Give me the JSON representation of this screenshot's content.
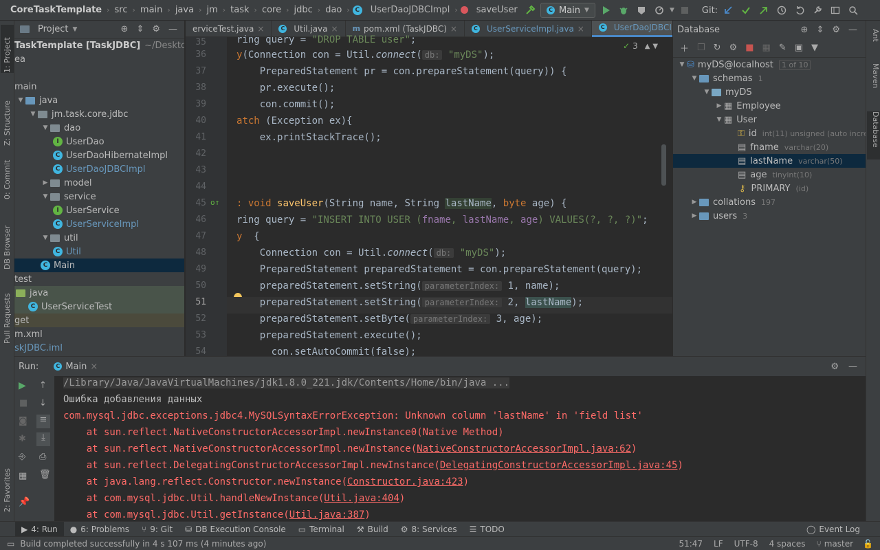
{
  "navbar": {
    "breadcrumbs": [
      "CoreTaskTemplate",
      "src",
      "main",
      "java",
      "jm",
      "task",
      "core",
      "jdbc",
      "dao"
    ],
    "file": "UserDaoJDBCImpl",
    "method": "saveUser",
    "run_config": "Main",
    "git_label": "Git:"
  },
  "left_stripe": {
    "project": "1: Project",
    "structure": "Z: Structure",
    "commit": "0: Commit",
    "db_browser": "DB Browser",
    "pull_requests": "Pull Requests",
    "favorites": "2: Favorites"
  },
  "right_stripe": {
    "ant": "Ant",
    "maven": "Maven",
    "database": "Database"
  },
  "project_panel": {
    "title": "Project",
    "root": "TaskTemplate [TaskJDBC]",
    "root_path": "~/Desktop/pr",
    "items": [
      {
        "label": "ea",
        "indent": 0
      },
      {
        "label": "",
        "indent": 0
      },
      {
        "label": "main",
        "indent": 1
      },
      {
        "label": "java",
        "indent": 1
      },
      {
        "label": "jm.task.core.jdbc",
        "indent": 2
      },
      {
        "label": "dao",
        "indent": 3
      },
      {
        "label": "UserDao",
        "indent": 4
      },
      {
        "label": "UserDaoHibernateImpl",
        "indent": 4
      },
      {
        "label": "UserDaoJDBCImpl",
        "indent": 4
      },
      {
        "label": "model",
        "indent": 3
      },
      {
        "label": "service",
        "indent": 3
      },
      {
        "label": "UserService",
        "indent": 4
      },
      {
        "label": "UserServiceImpl",
        "indent": 4
      },
      {
        "label": "util",
        "indent": 3
      },
      {
        "label": "Util",
        "indent": 4
      },
      {
        "label": "Main",
        "indent": 3
      },
      {
        "label": "test",
        "indent": 0
      },
      {
        "label": "java",
        "indent": 0
      },
      {
        "label": "UserServiceTest",
        "indent": 1
      },
      {
        "label": "get",
        "indent": 0
      },
      {
        "label": "m.xml",
        "indent": 0
      },
      {
        "label": "skJDBC.iml",
        "indent": 0
      }
    ]
  },
  "editor": {
    "tabs": [
      "erviceTest.java",
      "Util.java",
      "pom.xml (TaskJDBC)",
      "UserServiceImpl.java",
      "UserDaoJDBCImpl.java"
    ],
    "inspection_count": "3",
    "lines": [
      {
        "n": "35"
      },
      {
        "n": "36"
      },
      {
        "n": "37"
      },
      {
        "n": "38"
      },
      {
        "n": "39"
      },
      {
        "n": "40"
      },
      {
        "n": "41"
      },
      {
        "n": "42"
      },
      {
        "n": "43"
      },
      {
        "n": "44"
      },
      {
        "n": "45"
      },
      {
        "n": "46"
      },
      {
        "n": "47"
      },
      {
        "n": "48"
      },
      {
        "n": "49"
      },
      {
        "n": "50"
      },
      {
        "n": "51"
      },
      {
        "n": "52"
      },
      {
        "n": "53"
      },
      {
        "n": "54"
      }
    ],
    "hints": {
      "db": "db:",
      "param_index": "parameterIndex:"
    },
    "text": {
      "l35_a": "ring query = ",
      "l35_b": "\"DROP TABLE user\"",
      "l35_c": ";",
      "l36_a": "y",
      "l36_b": "(Connection con = Util.",
      "l36_c": "connect",
      "l36_d": "(",
      "l36_e": "\"myDS\"",
      "l36_f": ");",
      "l37": "    PreparedStatement pr = con.prepareStatement(query)) {",
      "l38": "    pr.execute();",
      "l39": "    con.commit();",
      "l40_a": "atch",
      "l40_b": " (Exception ex){",
      "l41": "    ex.printStackTrace();",
      "l45_a": ": void ",
      "l45_b": "saveUser",
      "l45_c": "(String name, String ",
      "l45_d": "lastName",
      "l45_e": ", ",
      "l45_f": "byte",
      "l45_g": " age) {",
      "l46_a": "ring query = ",
      "l46_b": "\"INSERT INTO USER (",
      "l46_c": "fname",
      "l46_d": ", ",
      "l46_e": "lastName",
      "l46_f": ", ",
      "l46_g": "age",
      "l46_h": ") VALUES(?, ?, ?)\"",
      "l46_i": ";",
      "l47_a": "y",
      "l47_b": "  {",
      "l48_a": "    Connection con = Util.",
      "l48_b": "connect",
      "l48_c": "(",
      "l48_d": "\"myDS\"",
      "l48_e": ");",
      "l49": "    PreparedStatement preparedStatement = con.prepareStatement(query);",
      "l50_a": "    preparedStatement.setString(",
      "l50_b": "1, name);",
      "l51_a": "    preparedStatement.setString(",
      "l51_b": "2, ",
      "l51_c": "lastName",
      "l51_d": ");",
      "l52_a": "    preparedStatement.setByte(",
      "l52_b": "3, age);",
      "l53": "    preparedStatement.execute();",
      "l54": "      con.setAutoCommit(false);"
    }
  },
  "database_panel": {
    "title": "Database",
    "datasource": "myDS@localhost",
    "datasource_count": "1 of 10",
    "schemas": "schemas",
    "schemas_count": "1",
    "schema": "myDS",
    "tables": [
      "Employee",
      "User"
    ],
    "columns": [
      {
        "name": "id",
        "type": "int(11) unsigned (auto incre"
      },
      {
        "name": "fname",
        "type": "varchar(20)"
      },
      {
        "name": "lastName",
        "type": "varchar(50)"
      },
      {
        "name": "age",
        "type": "tinyint(10)"
      }
    ],
    "primary": {
      "name": "PRIMARY",
      "cols": "(id)"
    },
    "collations": "collations",
    "collations_count": "197",
    "users": "users",
    "users_count": "3"
  },
  "run_panel": {
    "label": "Run:",
    "tab": "Main",
    "lines": [
      {
        "text": "/Library/Java/JavaVirtualMachines/jdk1.8.0_221.jdk/Contents/Home/bin/java ...",
        "kind": "gray"
      },
      {
        "text": "Ошибка добавления данных",
        "kind": "white"
      },
      {
        "text": "com.mysql.jdbc.exceptions.jdbc4.MySQLSyntaxErrorException: Unknown column 'lastName' in 'field list'",
        "kind": "red"
      },
      {
        "pre": "    at sun.reflect.NativeConstructorAccessorImpl.newInstance0(",
        "link": "",
        "post": "Native Method)"
      },
      {
        "pre": "    at sun.reflect.NativeConstructorAccessorImpl.newInstance(",
        "link": "NativeConstructorAccessorImpl.java:62",
        "post": ")"
      },
      {
        "pre": "    at sun.reflect.DelegatingConstructorAccessorImpl.newInstance(",
        "link": "DelegatingConstructorAccessorImpl.java:45",
        "post": ")"
      },
      {
        "pre": "    at java.lang.reflect.Constructor.newInstance(",
        "link": "Constructor.java:423",
        "post": ")"
      },
      {
        "pre": "    at com.mysql.jdbc.Util.handleNewInstance(",
        "link": "Util.java:404",
        "post": ")"
      },
      {
        "pre": "    at com.mysql.jdbc.Util.getInstance(",
        "link": "Util.java:387",
        "post": ")"
      }
    ]
  },
  "bottom_tools": {
    "run": "4: Run",
    "problems": "6: Problems",
    "git": "9: Git",
    "db_console": "DB Execution Console",
    "terminal": "Terminal",
    "build": "Build",
    "services": "8: Services",
    "todo": "TODO",
    "event_log": "Event Log"
  },
  "status": {
    "message": "Build completed successfully in 4 s 107 ms (4 minutes ago)",
    "position": "51:47",
    "line_sep": "LF",
    "encoding": "UTF-8",
    "indent": "4 spaces",
    "branch": "master"
  },
  "colors": {
    "accent": "#4a88c7",
    "error": "#ff6b68",
    "keyword": "#cc7832",
    "string": "#6a8759",
    "function": "#ffc66d"
  }
}
